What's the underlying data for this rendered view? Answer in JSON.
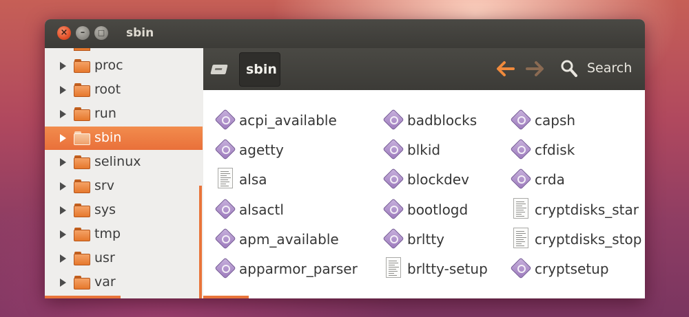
{
  "window": {
    "title": "sbin"
  },
  "sidebar": {
    "items": [
      {
        "label": "proc",
        "selected": false
      },
      {
        "label": "root",
        "selected": false
      },
      {
        "label": "run",
        "selected": false
      },
      {
        "label": "sbin",
        "selected": true
      },
      {
        "label": "selinux",
        "selected": false
      },
      {
        "label": "srv",
        "selected": false
      },
      {
        "label": "sys",
        "selected": false
      },
      {
        "label": "tmp",
        "selected": false
      },
      {
        "label": "usr",
        "selected": false
      },
      {
        "label": "var",
        "selected": false
      }
    ]
  },
  "toolbar": {
    "breadcrumb": "sbin",
    "search_label": "Search"
  },
  "files": {
    "col1": [
      {
        "name": "acpi_available",
        "type": "executable"
      },
      {
        "name": "agetty",
        "type": "executable"
      },
      {
        "name": "alsa",
        "type": "script"
      },
      {
        "name": "alsactl",
        "type": "executable"
      },
      {
        "name": "apm_available",
        "type": "executable"
      },
      {
        "name": "apparmor_parser",
        "type": "executable"
      }
    ],
    "col2": [
      {
        "name": "badblocks",
        "type": "executable"
      },
      {
        "name": "blkid",
        "type": "executable"
      },
      {
        "name": "blockdev",
        "type": "executable"
      },
      {
        "name": "bootlogd",
        "type": "executable"
      },
      {
        "name": "brltty",
        "type": "executable"
      },
      {
        "name": "brltty-setup",
        "type": "script"
      }
    ],
    "col3": [
      {
        "name": "capsh",
        "type": "executable"
      },
      {
        "name": "cfdisk",
        "type": "executable"
      },
      {
        "name": "crda",
        "type": "executable"
      },
      {
        "name": "cryptdisks_star",
        "type": "script"
      },
      {
        "name": "cryptdisks_stop",
        "type": "script"
      },
      {
        "name": "cryptsetup",
        "type": "executable"
      }
    ]
  },
  "colors": {
    "accent": "#e9703a",
    "titlebar": "#3c3b37",
    "executable_icon": "#9d7bbd"
  }
}
